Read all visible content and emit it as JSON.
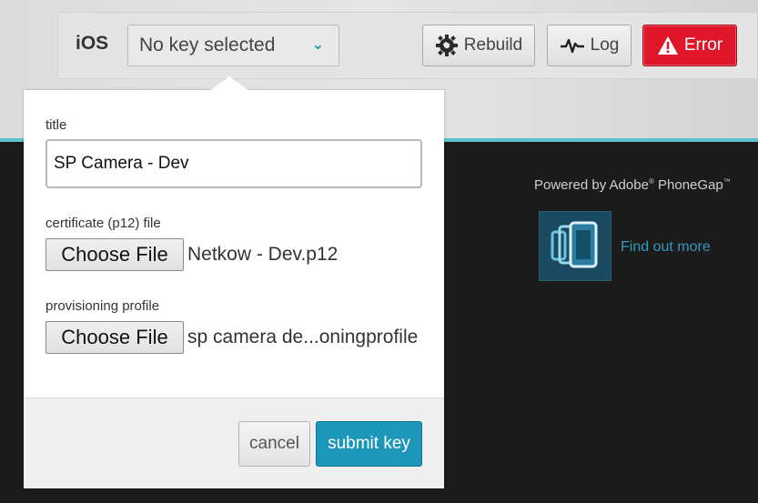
{
  "toolbar": {
    "platform": "iOS",
    "key_select": {
      "value": "No key selected",
      "icon": "chevron-down-icon"
    },
    "rebuild_label": "Rebuild",
    "log_label": "Log",
    "error_label": "Error"
  },
  "colors": {
    "accent_teal": "#5bc3cc",
    "error_red": "#e0162b",
    "submit_blue": "#1d97b9",
    "link_blue": "#2f9bbd"
  },
  "promo": {
    "powered_prefix": "Powered by Adobe",
    "powered_suffix": "PhoneGap",
    "reg_mark": "®",
    "tm_mark": "™",
    "find_more": "Find out more"
  },
  "form": {
    "title_label": "title",
    "title_value": "SP Camera - Dev",
    "cert_label": "certificate (p12) file",
    "cert_button": "Choose File",
    "cert_file": "Netkow - Dev.p12",
    "profile_label": "provisioning profile",
    "profile_button": "Choose File",
    "profile_file": "sp camera de...oningprofile",
    "cancel_label": "cancel",
    "submit_label": "submit key"
  }
}
